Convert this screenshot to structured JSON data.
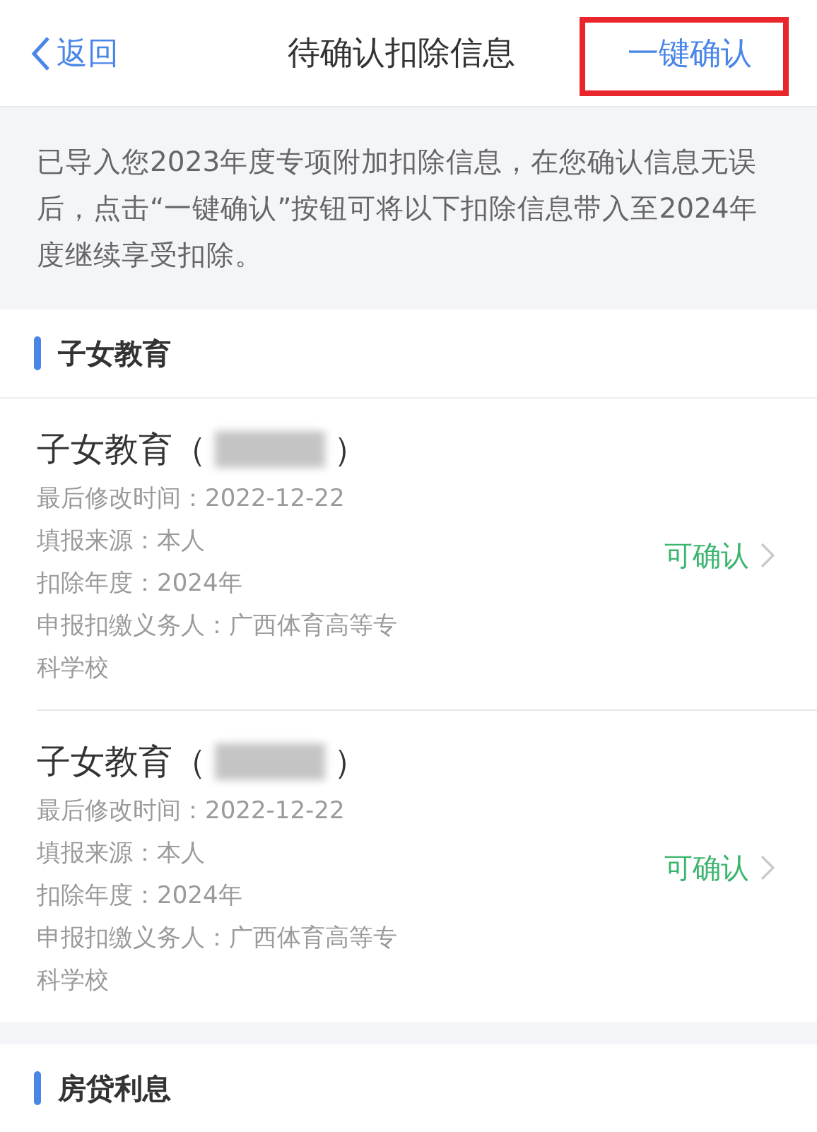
{
  "nav": {
    "back": "返回",
    "title": "待确认扣除信息",
    "action": "一键确认",
    "action_highlighted": true
  },
  "notice": "已导入您2023年度专项附加扣除信息，在您确认信息无误后，点击“一键确认”按钮可将以下扣除信息带入至2024年度继续享受扣除。",
  "sections": [
    {
      "title": "子女教育",
      "items": [
        {
          "title": "子女教育（",
          "title_close": "）",
          "name_redacted": true,
          "fields": [
            "最后修改时间：2022-12-22",
            "填报来源：本人",
            "扣除年度：2024年",
            "申报扣缴义务人：广西体育高等专科学校"
          ],
          "status": "可确认"
        },
        {
          "title": "子女教育（",
          "title_close": "）",
          "name_redacted": true,
          "fields": [
            "最后修改时间：2022-12-22",
            "填报来源：本人",
            "扣除年度：2024年",
            "申报扣缴义务人：广西体育高等专科学校"
          ],
          "status": "可确认"
        }
      ]
    },
    {
      "title": "房贷利息"
    }
  ]
}
